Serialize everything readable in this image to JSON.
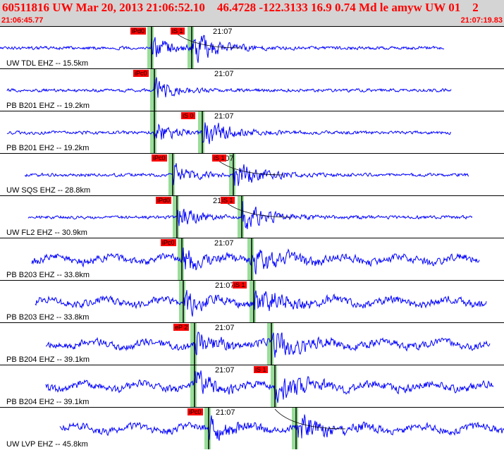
{
  "header": {
    "title": "60511816 UW Mar 20, 2013 21:06:52.10    46.4728 -122.3133 16.9 0.74 Md le amyw UW 01    2",
    "start_time": "21:06:45.77",
    "end_time": "21:07:19.83"
  },
  "colors": {
    "header_bg": "#d4d4d4",
    "header_text": "#ff0000",
    "trace": "#0000ff",
    "pick": "#ff0000",
    "window": "#99dd99"
  },
  "minute_marker": "21:07",
  "traces": [
    {
      "label": "UW TDL EHZ -- 15.5km",
      "picks": [
        "iPd0",
        "iS 1"
      ]
    },
    {
      "label": "PB B201 EHZ -- 19.2km",
      "picks": [
        "iPc0"
      ]
    },
    {
      "label": "PB B201 EH2 -- 19.2km",
      "picks": [
        "iS 0"
      ]
    },
    {
      "label": "UW SQS EHZ -- 28.8km",
      "picks": [
        "iPc0",
        "iS 1"
      ]
    },
    {
      "label": "UW FL2 EHZ -- 30.9km",
      "picks": [
        "iPd0",
        "iS 1"
      ]
    },
    {
      "label": "PB B203 EHZ -- 33.8km",
      "picks": [
        "iPc0"
      ]
    },
    {
      "label": "PB B203 EH2 -- 33.8km",
      "picks": [
        "iS 1"
      ]
    },
    {
      "label": "PB B204 EHZ -- 39.1km",
      "picks": [
        "eP 2"
      ]
    },
    {
      "label": "PB B204 EH2 -- 39.1km",
      "picks": [
        "iS 1"
      ]
    },
    {
      "label": "UW LVP EHZ -- 45.8km",
      "picks": [
        "iPc0"
      ]
    }
  ]
}
